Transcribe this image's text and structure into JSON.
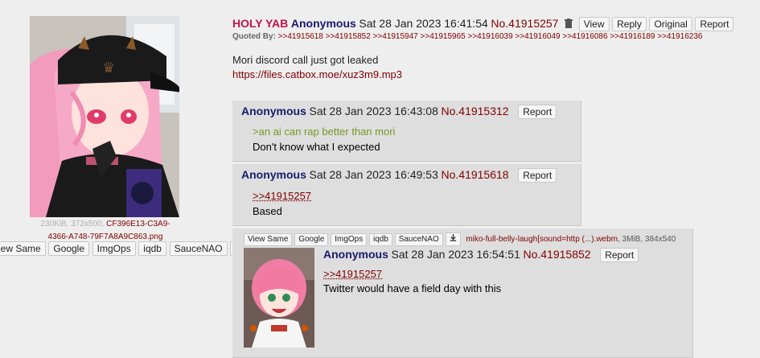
{
  "op": {
    "subject": "HOLY YAB",
    "name": "Anonymous",
    "date": "Sat 28 Jan 2023 16:41:54",
    "number": "No.41915257",
    "buttons": [
      "View",
      "Reply",
      "Original",
      "Report"
    ],
    "quoted_by_label": "Quoted By:",
    "quoted_by": ">>41915618 >>41915852 >>41915947 >>41915965 >>41916039 >>41916049 >>41916086 >>41916189 >>41916236",
    "message_line1": "Mori discord call just got leaked",
    "message_link": "https://files.catbox.moe/xuz3m9.mp3",
    "file_meta": "230KiB, 372x500,",
    "file_name_1": "CF396E13-C3A9-",
    "file_name_2": "4366-A748-79F7A8A9C863.png",
    "file_buttons": [
      "iew Same",
      "Google",
      "ImgOps",
      "iqdb",
      "SauceNAO"
    ]
  },
  "replies": [
    {
      "name": "Anonymous",
      "date": "Sat 28 Jan 2023 16:43:08",
      "number": "No.41915312",
      "report": "Report",
      "greentext": ">an ai can rap better than mori",
      "text": "Don't know what I expected"
    },
    {
      "name": "Anonymous",
      "date": "Sat 28 Jan 2023 16:49:53",
      "number": "No.41915618",
      "report": "Report",
      "quote": ">>41915257",
      "text": "Based"
    },
    {
      "name": "Anonymous",
      "date": "Sat 28 Jan 2023 16:54:51",
      "number": "No.41915852",
      "report": "Report",
      "quote": ">>41915257",
      "text": "Twitter would have a field day with this",
      "file_buttons": [
        "View Same",
        "Google",
        "ImgOps",
        "iqdb",
        "SauceNAO"
      ],
      "file_name": "miko-full-belly-laugh[sound=http (...).webm",
      "file_meta": ", 3MiB, 384x540"
    }
  ],
  "icons": {
    "delete": "trash-icon",
    "download": "download-icon"
  }
}
